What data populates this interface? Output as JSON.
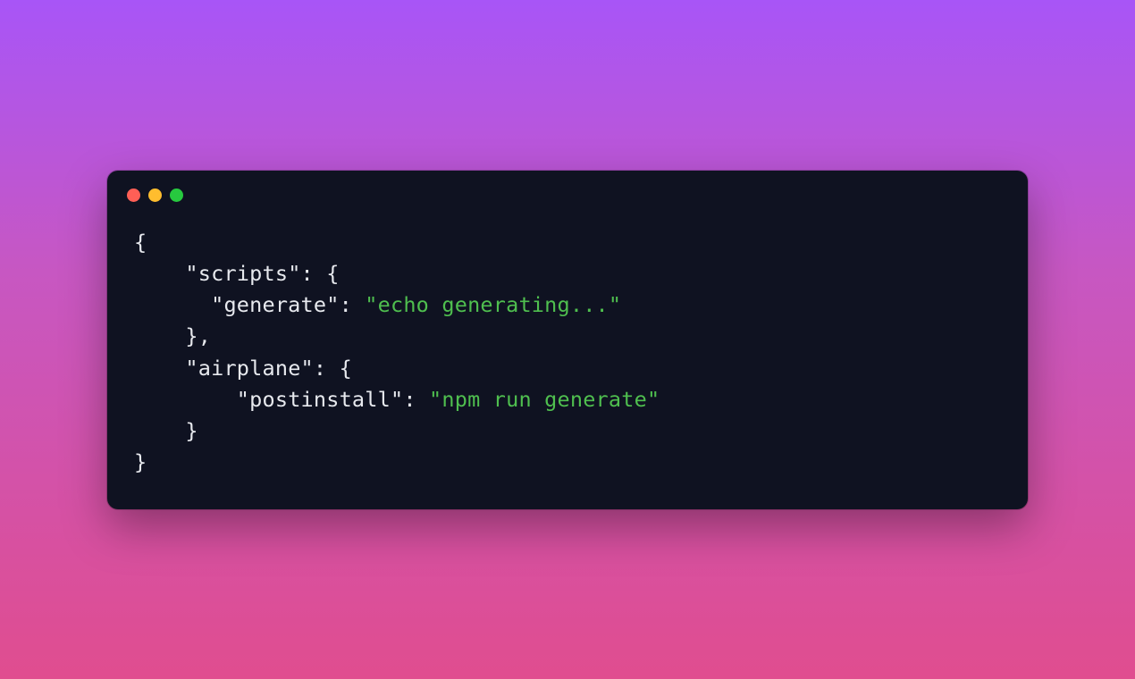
{
  "colors": {
    "terminal_bg": "#0f1221",
    "text_default": "#e7e9ee",
    "string_value": "#4fbf4f",
    "dot_red": "#ff5f56",
    "dot_yellow": "#ffbd2e",
    "dot_green": "#27c93f"
  },
  "code": {
    "l1": "{",
    "l2_indent": "    ",
    "l2_key": "\"scripts\"",
    "l2_after": ": {",
    "l3_indent": "      ",
    "l3_key": "\"generate\"",
    "l3_sep": ": ",
    "l3_val": "\"echo generating...\"",
    "l4_indent": "    ",
    "l4": "},",
    "l5_indent": "    ",
    "l5_key": "\"airplane\"",
    "l5_after": ": {",
    "l6_indent": "        ",
    "l6_key": "\"postinstall\"",
    "l6_sep": ": ",
    "l6_val": "\"npm run generate\"",
    "l7_indent": "    ",
    "l7": "}",
    "l8": "}"
  }
}
